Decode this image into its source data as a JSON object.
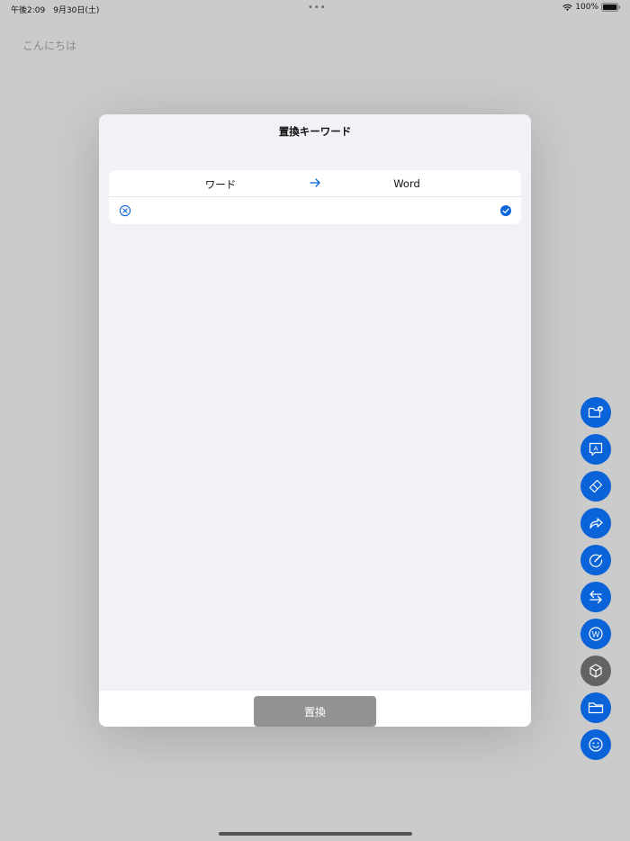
{
  "status_bar": {
    "time": "午後2:09　9月30日(土)",
    "dots": "•••",
    "battery": "100%"
  },
  "note": {
    "text": "こんにちは"
  },
  "modal": {
    "title": "置換キーワード",
    "header_row": {
      "from": "ワード",
      "to": "Word"
    },
    "replace_button": "置換"
  },
  "toolbar": {
    "buttons": [
      {
        "icon": "folder-plus-icon",
        "color": "#0a63d8"
      },
      {
        "icon": "speech-bubble-a-icon",
        "color": "#0a63d8"
      },
      {
        "icon": "eraser-icon",
        "color": "#0a63d8"
      },
      {
        "icon": "share-arrow-icon",
        "color": "#0a63d8"
      },
      {
        "icon": "circle-pen-icon",
        "color": "#0a63d8"
      },
      {
        "icon": "swap-arrows-icon",
        "color": "#0a63d8"
      },
      {
        "icon": "circle-w-icon",
        "color": "#0a63d8"
      },
      {
        "icon": "cube-icon",
        "color": "#636366"
      },
      {
        "icon": "folder-icon",
        "color": "#0a63d8"
      },
      {
        "icon": "smiley-icon",
        "color": "#0a63d8"
      }
    ]
  },
  "colors": {
    "accent": "#0a63d8",
    "disabled_button": "#929295",
    "modal_bg": "#f1f1f6"
  }
}
